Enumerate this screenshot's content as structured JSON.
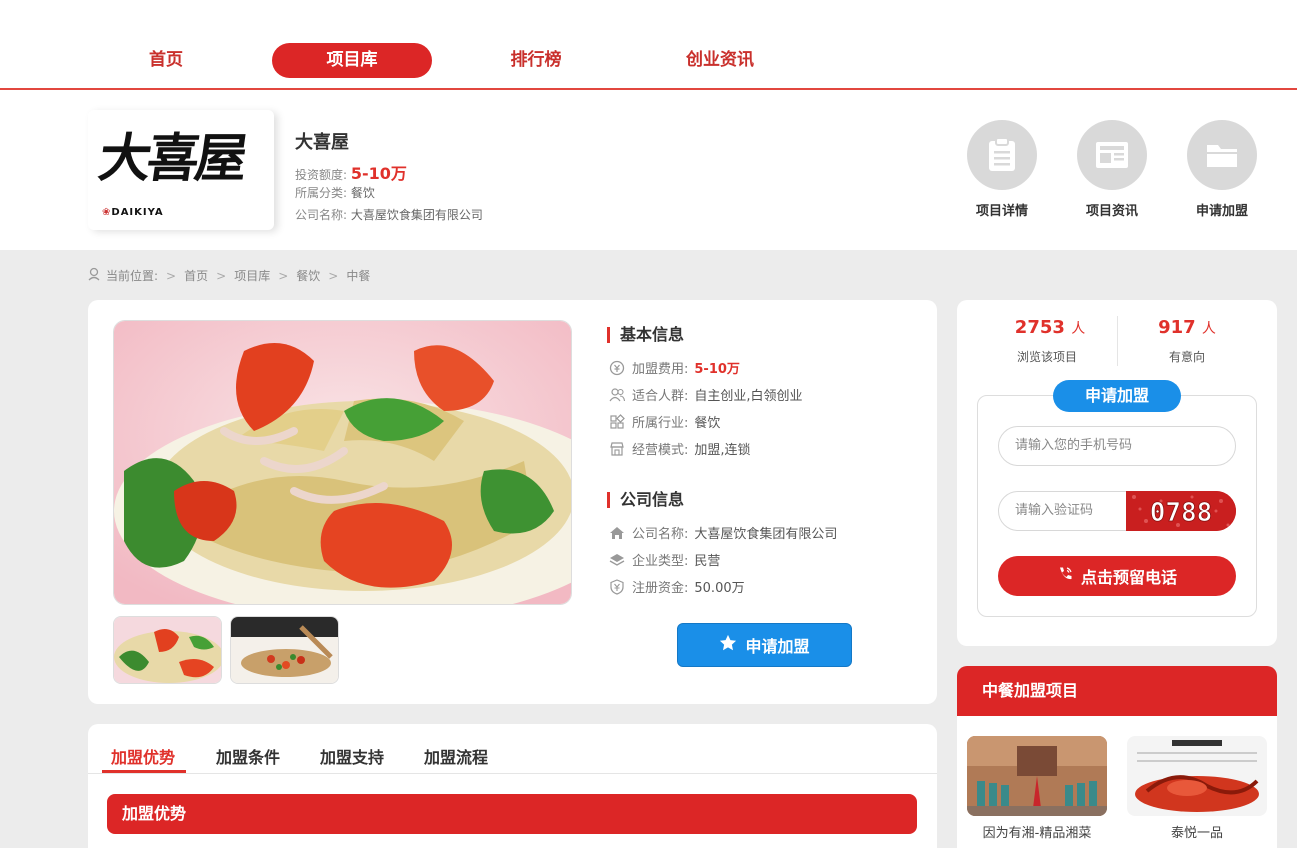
{
  "nav": {
    "items": [
      {
        "label": "首页"
      },
      {
        "label": "项目库",
        "active": true
      },
      {
        "label": "排行榜"
      },
      {
        "label": "创业资讯"
      }
    ]
  },
  "header": {
    "logo_text": "大喜屋",
    "logo_sub": "DAIKIYA",
    "title": "大喜屋",
    "invest_label": "投资额度:",
    "invest_value": "5-10万",
    "category_label": "所属分类:",
    "category_value": "餐饮",
    "company_label": "公司名称:",
    "company_value": "大喜屋饮食集团有限公司",
    "quick_links": [
      {
        "label": "项目详情",
        "icon": "clipboard-icon"
      },
      {
        "label": "项目资讯",
        "icon": "newspaper-icon"
      },
      {
        "label": "申请加盟",
        "icon": "folder-icon"
      }
    ]
  },
  "breadcrumb": {
    "prefix": "当前位置:",
    "items": [
      "首页",
      "项目库",
      "餐饮",
      "中餐"
    ]
  },
  "basic_info": {
    "title": "基本信息",
    "fee_label": "加盟费用:",
    "fee_value": "5-10万",
    "crowd_label": "适合人群:",
    "crowd_value": "自主创业,白领创业",
    "industry_label": "所属行业:",
    "industry_value": "餐饮",
    "mode_label": "经营模式:",
    "mode_value": "加盟,连锁"
  },
  "company_info": {
    "title": "公司信息",
    "name_label": "公司名称:",
    "name_value": "大喜屋饮食集团有限公司",
    "type_label": "企业类型:",
    "type_value": "民营",
    "capital_label": "注册资金:",
    "capital_value": "50.00万"
  },
  "apply_button": "申请加盟",
  "tabs": [
    {
      "label": "加盟优势",
      "active": true
    },
    {
      "label": "加盟条件"
    },
    {
      "label": "加盟支持"
    },
    {
      "label": "加盟流程"
    }
  ],
  "section_bar": "加盟优势",
  "stats": {
    "views": "2753",
    "views_unit": "人",
    "views_label": "浏览该项目",
    "intent": "917",
    "intent_unit": "人",
    "intent_label": "有意向"
  },
  "form": {
    "title": "申请加盟",
    "phone_placeholder": "请输入您的手机号码",
    "code_placeholder": "请输入验证码",
    "captcha": "0788",
    "submit": "点击预留电话"
  },
  "recommend": {
    "title": "中餐加盟项目",
    "items": [
      {
        "label": "因为有湘-精品湘菜"
      },
      {
        "label": "泰悦一品"
      }
    ]
  },
  "colors": {
    "brand_red": "#dc2626",
    "accent_blue": "#1a8fe8",
    "price_red": "#e0312b"
  }
}
